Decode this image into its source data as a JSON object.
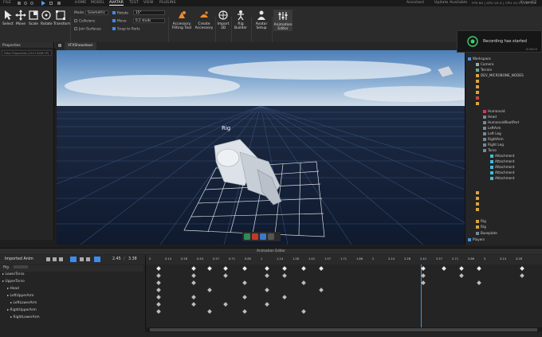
{
  "titlebar": {
    "file": "FILE",
    "tabs": [
      "HOME",
      "MODEL",
      "AVATAR",
      "TEST",
      "VIEW",
      "PLUGINS"
    ],
    "active_tab": "AVATAR",
    "assistant": "Assistant",
    "update": "Update Available",
    "stats": "FPS 60 | GPU 25.0 | CPU 10.3 | LAT 0.0",
    "user": "Kravolt2"
  },
  "ribbon": {
    "tools": [
      "Select",
      "Move",
      "Scale",
      "Rotate",
      "Transform"
    ],
    "tools_group": "Tools",
    "mode_label": "Mode:",
    "mode_value": "Geometric",
    "collisions": "Collisions",
    "join_surfaces": "Join Surfaces",
    "rotate_label": "Rotate",
    "rotate_value": "15°",
    "move_label": "Move",
    "move_value": "0.2 studs",
    "snap_parts": "Snap to Parts",
    "snapping_group": "Snapping",
    "accessory_buttons": [
      {
        "label": "Accessory Fitting Tool",
        "group": ""
      },
      {
        "label": "Create Accessory",
        "group": ""
      }
    ],
    "accessory_group": "Accessory",
    "import_3d": "Import 3D",
    "file_group": "File",
    "rig_builder": "Rig Builder",
    "rig_group": "Rig",
    "avatar_setup": "Avatar Setup",
    "setup_group": "Setup",
    "animation_editor": "Animation Editor",
    "animation_group": "Animation"
  },
  "left_panel": {
    "title": "Properties",
    "filter": "Filter Properties (Ctrl+Shift+P)"
  },
  "viewport": {
    "tab": "VFXShowdown",
    "rig_label": "Rig"
  },
  "toast": {
    "message": "Recording has started",
    "time": "0:00:03"
  },
  "explorer": {
    "items": [
      {
        "label": "Workspace",
        "indent": 0
      },
      {
        "label": "Camera",
        "indent": 1
      },
      {
        "label": "Terrain",
        "indent": 1
      },
      {
        "label": "DEV_MICROBONE_NODES",
        "indent": 1
      },
      {
        "label": "",
        "indent": 1
      },
      {
        "label": "",
        "indent": 1
      },
      {
        "label": "",
        "indent": 1
      },
      {
        "label": "",
        "indent": 1
      },
      {
        "label": "",
        "indent": 1
      },
      {
        "label": "Humanoid",
        "indent": 2
      },
      {
        "label": "Head",
        "indent": 2
      },
      {
        "label": "HumanoidRootPart",
        "indent": 2
      },
      {
        "label": "LeftArm",
        "indent": 2
      },
      {
        "label": "Left Leg",
        "indent": 2
      },
      {
        "label": "RightArm",
        "indent": 2
      },
      {
        "label": "Right Leg",
        "indent": 2
      },
      {
        "label": "Torso",
        "indent": 2
      },
      {
        "label": "Attachment",
        "indent": 3
      },
      {
        "label": "Attachment",
        "indent": 3
      },
      {
        "label": "Attachment",
        "indent": 3
      },
      {
        "label": "Attachment",
        "indent": 3
      },
      {
        "label": "Attachment",
        "indent": 3
      },
      {
        "label": "",
        "indent": 1
      },
      {
        "label": "",
        "indent": 1
      },
      {
        "label": "",
        "indent": 1
      },
      {
        "label": "",
        "indent": 1
      },
      {
        "label": "Rig",
        "indent": 1
      },
      {
        "label": "Rig",
        "indent": 1
      },
      {
        "label": "Baseplate",
        "indent": 1
      },
      {
        "label": "Players",
        "indent": 0
      }
    ]
  },
  "animation_editor": {
    "title": "Animation Editor",
    "anim_name": "Imported Anim",
    "current_time": "2.45",
    "end_time": "3.38",
    "root": "Rig",
    "ticks": [
      "0",
      "0.14",
      "0.28",
      "0.43",
      "0.57",
      "0.71",
      "0.85",
      "1",
      "1.14",
      "1.28",
      "1.42",
      "1.57",
      "1.71",
      "1.86",
      "2",
      "2.14",
      "2.28",
      "2.42",
      "2.57",
      "2.71",
      "2.86",
      "3",
      "3.14",
      "3.28"
    ],
    "tracks": [
      {
        "label": "LowerTorso",
        "indent": 0
      },
      {
        "label": "UpperTorso",
        "indent": 1
      },
      {
        "label": "Head",
        "indent": 2
      },
      {
        "label": "LeftUpperArm",
        "indent": 2
      },
      {
        "label": "LeftLowerArm",
        "indent": 3
      },
      {
        "label": "RightUpperArm",
        "indent": 2
      },
      {
        "label": "RightLowerArm",
        "indent": 3
      }
    ]
  }
}
